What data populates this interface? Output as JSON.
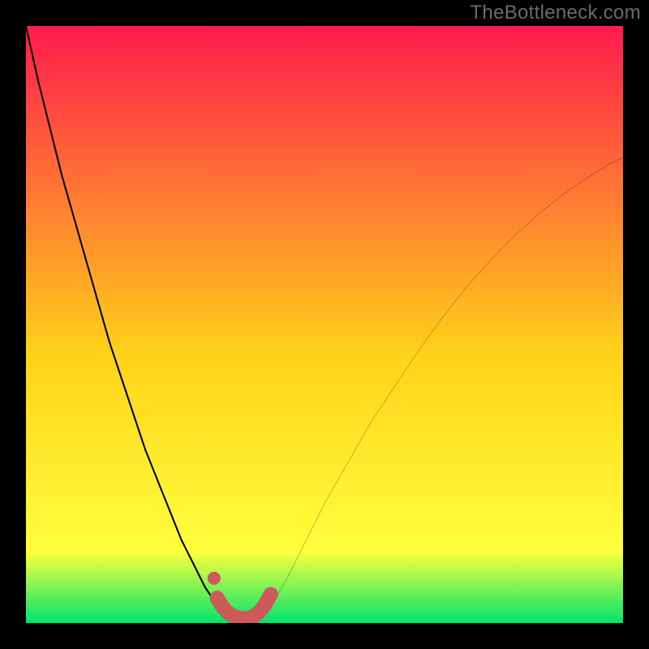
{
  "watermark": "TheBottleneck.com",
  "chart_data": {
    "type": "line",
    "title": "",
    "xlabel": "",
    "ylabel": "",
    "xlim": [
      0,
      100
    ],
    "ylim": [
      0,
      100
    ],
    "grid": false,
    "legend": false,
    "background_gradient": {
      "top_color": "#ff1a4d",
      "mid_color": "#ffd21a",
      "lower_color": "#ffff3d",
      "bottom_color": "#00e56b"
    },
    "series": [
      {
        "name": "left-curve",
        "stroke": "#000000",
        "x": [
          0,
          2,
          4,
          6,
          8,
          10,
          12,
          14,
          16,
          18,
          20,
          22,
          24,
          26,
          28,
          30,
          31,
          32,
          33,
          34
        ],
        "y": [
          100,
          91,
          83,
          75,
          68,
          61,
          54,
          47,
          41,
          35,
          29,
          24,
          19,
          14,
          10,
          6,
          4.5,
          3,
          1.8,
          1
        ]
      },
      {
        "name": "right-curve",
        "stroke": "#000000",
        "x": [
          39,
          40,
          42,
          44,
          46,
          48,
          50,
          54,
          58,
          62,
          66,
          70,
          74,
          78,
          82,
          86,
          90,
          94,
          98,
          100
        ],
        "y": [
          1,
          2,
          4.5,
          8,
          12,
          16,
          20,
          27,
          34,
          40,
          46,
          51.5,
          56.5,
          61,
          65,
          68.6,
          71.8,
          74.6,
          77,
          78
        ]
      },
      {
        "name": "marker-dot",
        "type": "scatter",
        "color": "#cc5a5a",
        "x": [
          31.5
        ],
        "y": [
          7.5
        ]
      },
      {
        "name": "thick-segment",
        "stroke": "#cc5a5a",
        "stroke_width": 18,
        "x": [
          32,
          33,
          34,
          35,
          36,
          37,
          38,
          39,
          40,
          41
        ],
        "y": [
          4.2,
          2.6,
          1.6,
          1.0,
          0.8,
          0.8,
          1.0,
          1.8,
          3.0,
          4.8
        ]
      }
    ]
  }
}
